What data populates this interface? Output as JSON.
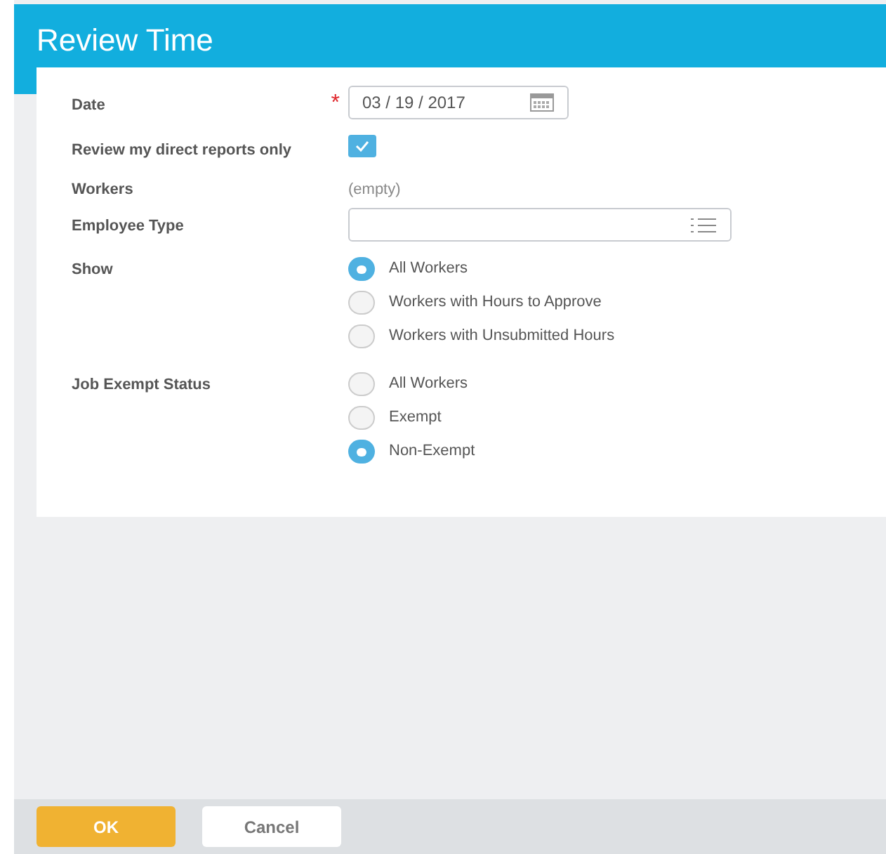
{
  "window": {
    "title": "Review Time"
  },
  "form": {
    "date": {
      "label": "Date",
      "required_mark": "*",
      "value": "03 / 19 / 2017"
    },
    "direct_reports": {
      "label": "Review my direct reports only",
      "checked": true
    },
    "workers": {
      "label": "Workers",
      "value": "(empty)"
    },
    "employee_type": {
      "label": "Employee Type"
    },
    "radio_groups": [
      {
        "label": "Show",
        "options": [
          {
            "label": "All Workers",
            "selected": true
          },
          {
            "label": "Workers with Hours to Approve",
            "selected": false
          },
          {
            "label": "Workers with Unsubmitted Hours",
            "selected": false
          }
        ]
      },
      {
        "label": "Job Exempt Status",
        "options": [
          {
            "label": "All Workers",
            "selected": false
          },
          {
            "label": "Exempt",
            "selected": false
          },
          {
            "label": "Non-Exempt",
            "selected": true
          }
        ]
      }
    ]
  },
  "buttons": [
    {
      "label": "OK",
      "kind": "primary"
    },
    {
      "label": "Cancel",
      "kind": "secondary"
    }
  ]
}
